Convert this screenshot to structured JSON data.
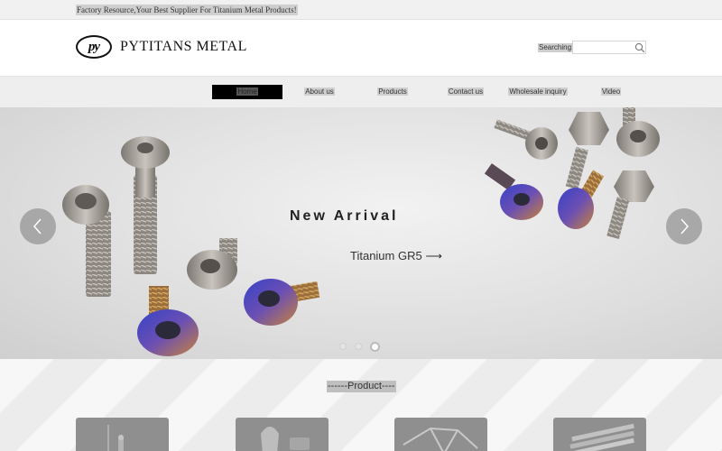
{
  "topbar": {
    "slogan": "Factory Resource,Your Best Supplier For Titanium Metal Products!"
  },
  "header": {
    "logo_text": "py",
    "brand": "PYTITANS METAL",
    "search_label": "Searching:",
    "search_value": "",
    "search_placeholder": ""
  },
  "nav": {
    "items": [
      {
        "label": "Home",
        "active": true
      },
      {
        "label": "About us"
      },
      {
        "label": "Products"
      },
      {
        "label": "Contact us"
      },
      {
        "label": "Wholesale inquiry"
      },
      {
        "label": "Video"
      }
    ]
  },
  "banner": {
    "title": "New Arrival",
    "subtitle": "Titanium GR5 ⟶",
    "slides": 3,
    "active_slide": 3
  },
  "products": {
    "title": "------Product----"
  },
  "colors": {
    "accent_dark": "#000000",
    "anodized_blue": "#3a49b8",
    "titanium_gray": "#a7a29c",
    "text_highlight": "#cfcfcf"
  }
}
